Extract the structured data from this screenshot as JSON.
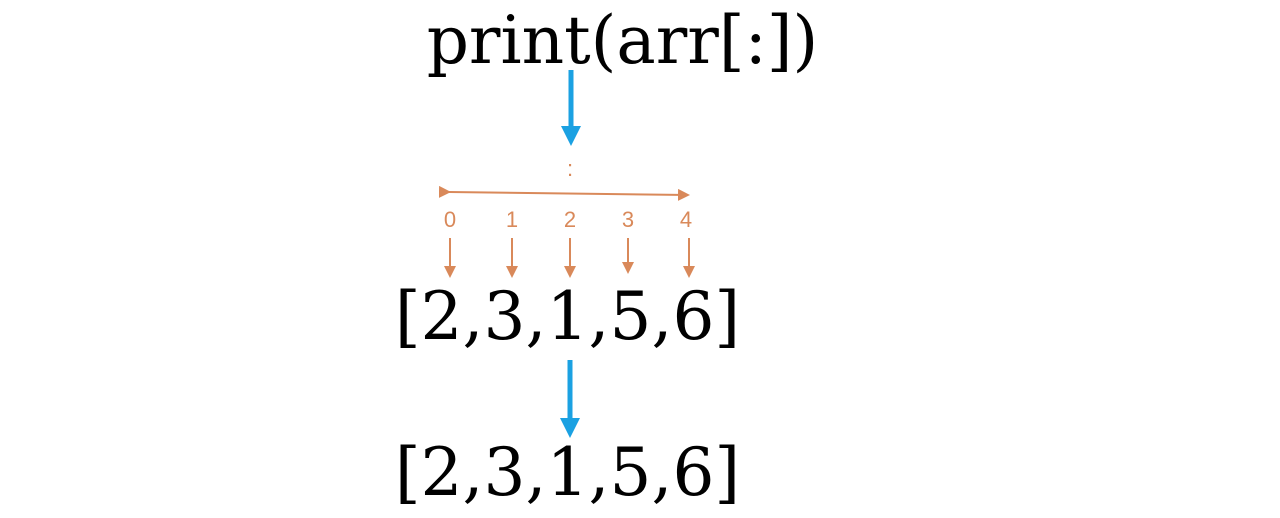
{
  "code": "print(arr[:])",
  "slice_label": ":",
  "indices": [
    "0",
    "1",
    "2",
    "3",
    "4"
  ],
  "input_array": "[2,3,1,5,6]",
  "output_array": "[2,3,1,5,6]",
  "colors": {
    "flow_arrow": "#1ba1e2",
    "index_color": "#d9895a",
    "text": "#000000"
  }
}
